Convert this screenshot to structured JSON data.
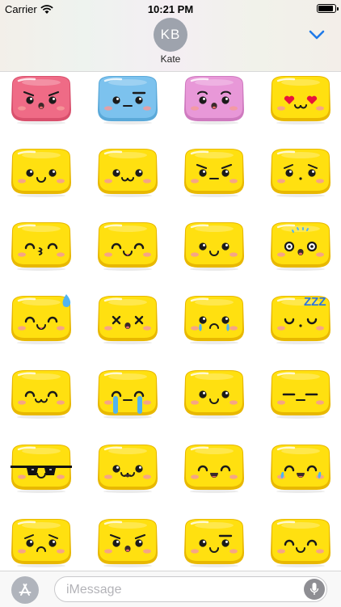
{
  "status_bar": {
    "carrier": "Carrier",
    "time": "10:21 PM"
  },
  "conversation": {
    "avatar_initials": "KB",
    "contact_name": "Kate"
  },
  "stickers": [
    {
      "color": "#ef6b86",
      "rim": "#d9506d",
      "icon": "angry-sticker-icon",
      "mouth": "o",
      "brows": "angry",
      "eyes": "dot"
    },
    {
      "color": "#7cc2ee",
      "rim": "#5aa9d9",
      "icon": "unamused-sticker-icon",
      "mouth": "flat",
      "brows": "raised",
      "eyes": "dot"
    },
    {
      "color": "#e898d8",
      "rim": "#cf7abf",
      "icon": "surprised-sticker-icon",
      "mouth": "o",
      "brows": "flat",
      "eyes": "dot"
    },
    {
      "color": "#ffe010",
      "rim": "#e8b800",
      "icon": "heart-eyes-sticker-icon",
      "mouth": "w",
      "eyes": "heart"
    },
    {
      "color": "#ffe010",
      "rim": "#e8b800",
      "icon": "smile-sticker-icon",
      "mouth": "smile",
      "eyes": "dot"
    },
    {
      "color": "#ffe010",
      "rim": "#e8b800",
      "icon": "cat-smile-sticker-icon",
      "mouth": "w",
      "eyes": "dot"
    },
    {
      "color": "#ffe010",
      "rim": "#e8b800",
      "icon": "annoyed-sticker-icon",
      "mouth": "flat",
      "brows": "angry",
      "eyes": "dot"
    },
    {
      "color": "#ffe010",
      "rim": "#e8b800",
      "icon": "worried-sticker-icon",
      "mouth": "dot",
      "brows": "sad",
      "eyes": "dot"
    },
    {
      "color": "#ffe010",
      "rim": "#e8b800",
      "icon": "kissing-sticker-icon",
      "mouth": "kiss",
      "eyes": "closed"
    },
    {
      "color": "#ffe010",
      "rim": "#e8b800",
      "icon": "tongue-sticker-icon",
      "mouth": "tongue",
      "eyes": "closed"
    },
    {
      "color": "#ffe010",
      "rim": "#e8b800",
      "icon": "happy-sticker-icon",
      "mouth": "smile",
      "eyes": "dot"
    },
    {
      "color": "#ffe010",
      "rim": "#e8b800",
      "icon": "shocked-sticker-icon",
      "mouth": "o",
      "eyes": "ring",
      "sweat": "top"
    },
    {
      "color": "#ffe010",
      "rim": "#e8b800",
      "icon": "sweat-smile-sticker-icon",
      "mouth": "tongue",
      "eyes": "closed",
      "drop": true
    },
    {
      "color": "#ffe010",
      "rim": "#e8b800",
      "icon": "dizzy-sticker-icon",
      "mouth": "o",
      "eyes": "cross"
    },
    {
      "color": "#ffe010",
      "rim": "#e8b800",
      "icon": "crying-sticker-icon",
      "mouth": "sad",
      "eyes": "dot",
      "tears": true
    },
    {
      "color": "#ffe010",
      "rim": "#e8b800",
      "icon": "sleeping-sticker-icon",
      "mouth": "dot",
      "eyes": "closedsmile",
      "zzz": true
    },
    {
      "color": "#ffe010",
      "rim": "#e8b800",
      "icon": "content-sticker-icon",
      "mouth": "w",
      "eyes": "closed"
    },
    {
      "color": "#ffe010",
      "rim": "#e8b800",
      "icon": "sobbing-sticker-icon",
      "mouth": "flat",
      "eyes": "closed",
      "bigtears": true
    },
    {
      "color": "#ffe010",
      "rim": "#e8b800",
      "icon": "smirk-sticker-icon",
      "mouth": "smile",
      "eyes": "dot"
    },
    {
      "color": "#ffe010",
      "rim": "#e8b800",
      "icon": "expressionless-sticker-icon",
      "mouth": "flat",
      "eyes": "line"
    },
    {
      "color": "#ffe010",
      "rim": "#e8b800",
      "icon": "sunglasses-sticker-icon",
      "mouth": "smile",
      "eyes": "glasses"
    },
    {
      "color": "#ffe010",
      "rim": "#e8b800",
      "icon": "laughing-sticker-icon",
      "mouth": "openw",
      "eyes": "dot"
    },
    {
      "color": "#ffe010",
      "rim": "#e8b800",
      "icon": "grin-sticker-icon",
      "mouth": "open",
      "eyes": "closed"
    },
    {
      "color": "#ffe010",
      "rim": "#e8b800",
      "icon": "joy-sticker-icon",
      "mouth": "open",
      "eyes": "closed",
      "smalltears": true
    },
    {
      "color": "#ffe010",
      "rim": "#e8b800",
      "icon": "sad-sticker-icon",
      "mouth": "sad",
      "brows": "sad",
      "eyes": "dot"
    },
    {
      "color": "#ffe010",
      "rim": "#e8b800",
      "icon": "mad-sticker-icon",
      "mouth": "o",
      "brows": "angry",
      "eyes": "dot"
    },
    {
      "color": "#ffe010",
      "rim": "#e8b800",
      "icon": "skeptical-sticker-icon",
      "mouth": "smile",
      "eyes": "dot",
      "brows": "raised"
    },
    {
      "color": "#ffe010",
      "rim": "#e8b800",
      "icon": "wink-sticker-icon",
      "mouth": "smile",
      "eyes": "closed"
    }
  ],
  "composer": {
    "placeholder": "iMessage"
  }
}
